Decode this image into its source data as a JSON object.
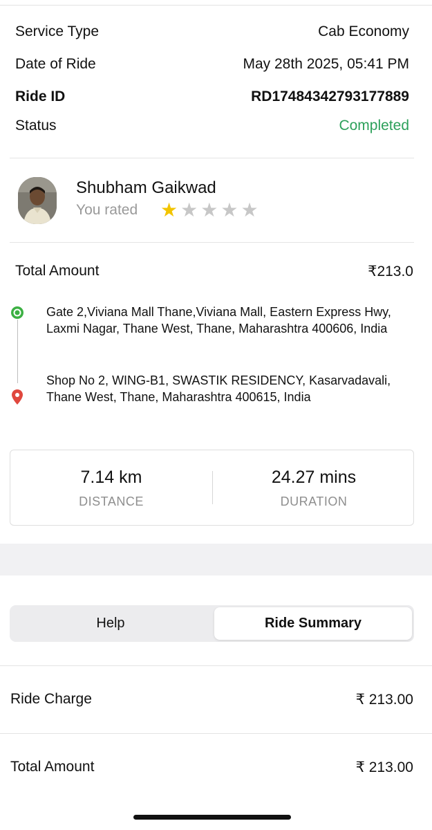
{
  "details": {
    "service_type_label": "Service Type",
    "service_type_value": "Cab Economy",
    "date_label": "Date of Ride",
    "date_value": "May 28th 2025, 05:41 PM",
    "ride_id_label": "Ride ID",
    "ride_id_value": "RD17484342793177889",
    "status_label": "Status",
    "status_value": "Completed"
  },
  "driver": {
    "name": "Shubham Gaikwad",
    "rated_label": "You rated",
    "rating": 1,
    "max_rating": 5
  },
  "total": {
    "label": "Total Amount",
    "value": "₹213.0"
  },
  "route": {
    "pickup_icon": "pickup-dot-icon",
    "drop_icon": "map-pin-icon",
    "pickup": "Gate 2,Viviana Mall Thane,Viviana Mall, Eastern Express Hwy, Laxmi Nagar, Thane West, Thane, Maharashtra 400606, India",
    "drop": "Shop No 2, WING-B1, SWASTIK RESIDENCY, Kasarvadavali, Thane West, Thane, Maharashtra 400615, India"
  },
  "stats": {
    "distance_value": "7.14 km",
    "distance_caption": "DISTANCE",
    "duration_value": "24.27 mins",
    "duration_caption": "DURATION"
  },
  "tabs": {
    "help": "Help",
    "summary": "Ride Summary",
    "active": "summary"
  },
  "summary": {
    "ride_charge_label": "Ride Charge",
    "ride_charge_value": "₹ 213.00",
    "total_label": "Total Amount",
    "total_value": "₹ 213.00"
  },
  "colors": {
    "completed": "#2ca05a",
    "pickup": "#3cb043",
    "drop": "#e0483e",
    "star_on": "#f2c400"
  }
}
